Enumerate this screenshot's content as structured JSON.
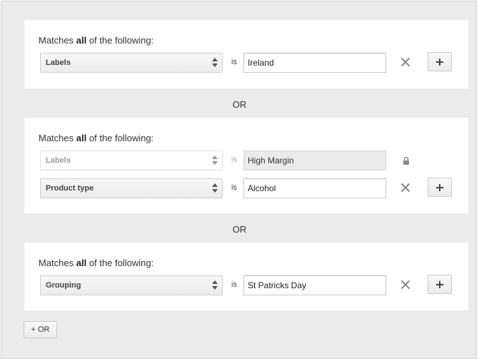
{
  "groups": [
    {
      "title_prefix": "Matches ",
      "title_strong": "all",
      "title_suffix": " of the following:",
      "rows": [
        {
          "field": "Labels",
          "operator": "is",
          "value": "Ireland",
          "locked": false
        }
      ]
    },
    {
      "title_prefix": "Matches ",
      "title_strong": "all",
      "title_suffix": " of the following:",
      "rows": [
        {
          "field": "Labels",
          "operator": "is",
          "value": "High Margin",
          "locked": true
        },
        {
          "field": "Product type",
          "operator": "is",
          "value": "Alcohol",
          "locked": false
        }
      ]
    },
    {
      "title_prefix": "Matches ",
      "title_strong": "all",
      "title_suffix": " of the following:",
      "rows": [
        {
          "field": "Grouping",
          "operator": "is",
          "value": "St Patricks Day",
          "locked": false
        }
      ]
    }
  ],
  "separators": [
    "OR",
    "OR"
  ],
  "add_or_label": "+ OR",
  "icons": {
    "remove": "close-icon",
    "lock": "lock-icon",
    "add": "plus-icon",
    "select_arrows": "sort-arrows-icon"
  },
  "colors": {
    "background": "#ebebeb",
    "panel": "#ffffff",
    "icon_gray": "#888888"
  }
}
